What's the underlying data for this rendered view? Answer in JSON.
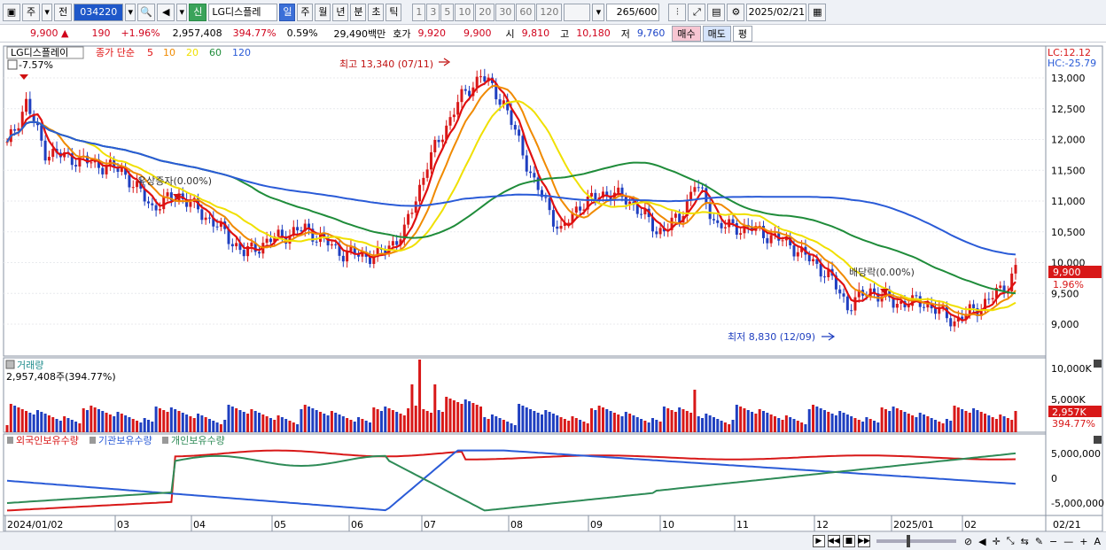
{
  "toolbar": {
    "market": "주",
    "prefix": "전",
    "code": "034220",
    "indicator": "신",
    "name": "LG디스플레",
    "periods": [
      "일",
      "주",
      "월",
      "년",
      "분",
      "초",
      "틱"
    ],
    "active_period": "일",
    "intervals": [
      "1",
      "3",
      "5",
      "10",
      "20",
      "30",
      "60",
      "120"
    ],
    "count": "265",
    "total": "/600",
    "date": "2025/02/21"
  },
  "info": {
    "price": "9,900",
    "change": "190",
    "change_pct": "+1.96%",
    "volume": "2,957,408",
    "volume_pct": "394.77%",
    "turnover": "0.59%",
    "amount": "29,490백만",
    "hoga_label": "호가",
    "ask": "9,920",
    "bid": "9,900",
    "open_label": "시",
    "open": "9,810",
    "high_label": "고",
    "high": "10,180",
    "low_label": "저",
    "low": "9,760",
    "buy": "매수",
    "sell": "매도",
    "eval": "평"
  },
  "price_panel": {
    "title": "LG디스플레이",
    "ma_label": "종가 단순",
    "ma_periods": [
      {
        "p": "5",
        "color": "#e01010"
      },
      {
        "p": "10",
        "color": "#f08a00"
      },
      {
        "p": "20",
        "color": "#f0e000"
      },
      {
        "p": "60",
        "color": "#1f8c3a"
      },
      {
        "p": "120",
        "color": "#2a5bd7"
      }
    ],
    "ytd": "-7.57%",
    "lc": "LC:12.12",
    "hc": "HC:-25.79",
    "yticks": [
      "13,000",
      "12,500",
      "12,000",
      "11,500",
      "11,000",
      "10,500",
      "10,000",
      "9,500",
      "9,000"
    ],
    "price_tag": "9,900",
    "pct_tag": "1.96%",
    "high_note": "최고 13,340 (07/11)",
    "low_note": "최저 8,830 (12/09)",
    "rights_note": "유상증자(0.00%)",
    "dividend_note": "배당락(0.00%)"
  },
  "volume_panel": {
    "title": "거래량",
    "value": "2,957,408주(394.77%)",
    "yticks": [
      "10,000K",
      "5,000K"
    ],
    "vol_tag": "2,957K",
    "vol_pct": "394.77%"
  },
  "holding_panel": {
    "series": [
      {
        "name": "외국인보유수량",
        "color": "#d81818"
      },
      {
        "name": "기관보유수량",
        "color": "#2a5bd7"
      },
      {
        "name": "개인보유수량",
        "color": "#2e8b57"
      }
    ],
    "yticks": [
      "5,000,000",
      "0",
      "-5,000,000"
    ]
  },
  "xaxis": [
    "2024/01/02",
    "03",
    "04",
    "05",
    "06",
    "07",
    "08",
    "09",
    "10",
    "11",
    "12",
    "2025/01",
    "02"
  ],
  "xaxis_right": "02/21",
  "colors": {
    "up": "#d81818",
    "down": "#1f3fc0",
    "panel_bg": "#ffffff"
  }
}
